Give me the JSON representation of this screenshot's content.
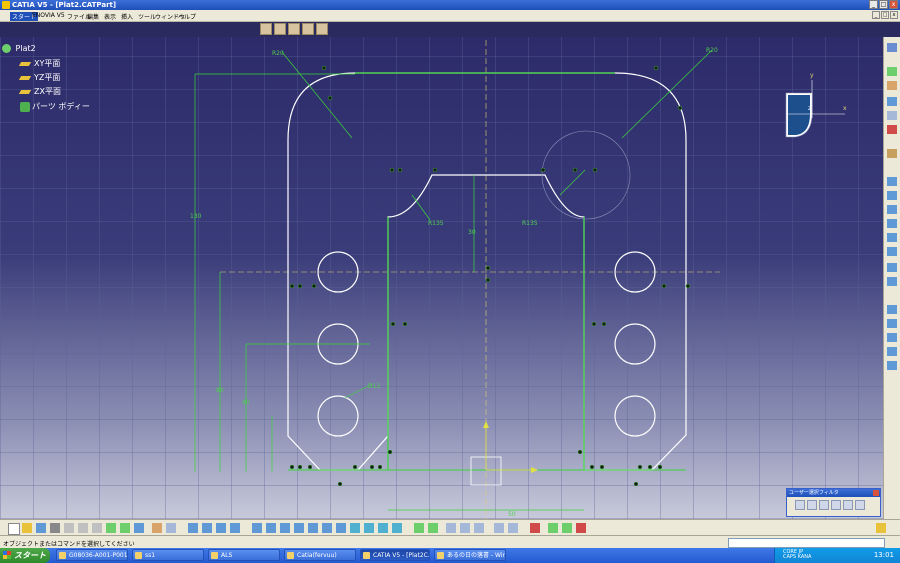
{
  "window": {
    "title": "CATIA V5 - [Plat2.CATPart]"
  },
  "menu": [
    "スタート",
    "ENOVIA V5",
    "ファイル",
    "編集",
    "表示",
    "挿入",
    "ツール",
    "ウィンドウ",
    "ヘルプ"
  ],
  "tree": {
    "root": "Plat2",
    "items": [
      "XY平面",
      "YZ平面",
      "ZX平面",
      "パーツ ボディー"
    ]
  },
  "dimensions": {
    "r20_left": "R20",
    "r20_right": "R20",
    "r135_left": "R135",
    "r135_right": "R135",
    "d30": "30",
    "d130": "130",
    "d80": "80",
    "d40": "40",
    "d50": "50",
    "d12": "D12"
  },
  "compass": {
    "x_label": "x",
    "y_label": "y",
    "z_label": "z"
  },
  "filter_panel": {
    "title": "ユーザー選択フィルタ"
  },
  "status": {
    "message": "オブジェクトまたはコマンドを選択してください"
  },
  "taskbar": {
    "start": "スタート",
    "tasks": [
      "G08036-A001-P001",
      "ss1",
      "ALS",
      "Catia(fervuu)",
      "CATIA V5 - [Plat2C...",
      "あるの日の落書 - Windo..."
    ],
    "clock": "13:01",
    "lang": "CORE JP\nCAPS KANA"
  },
  "colors": {
    "sketch_line": "#ffffff",
    "constraint": "#3ad63a",
    "axis_h": "#e0d070",
    "axis_v": "#e0d070"
  }
}
